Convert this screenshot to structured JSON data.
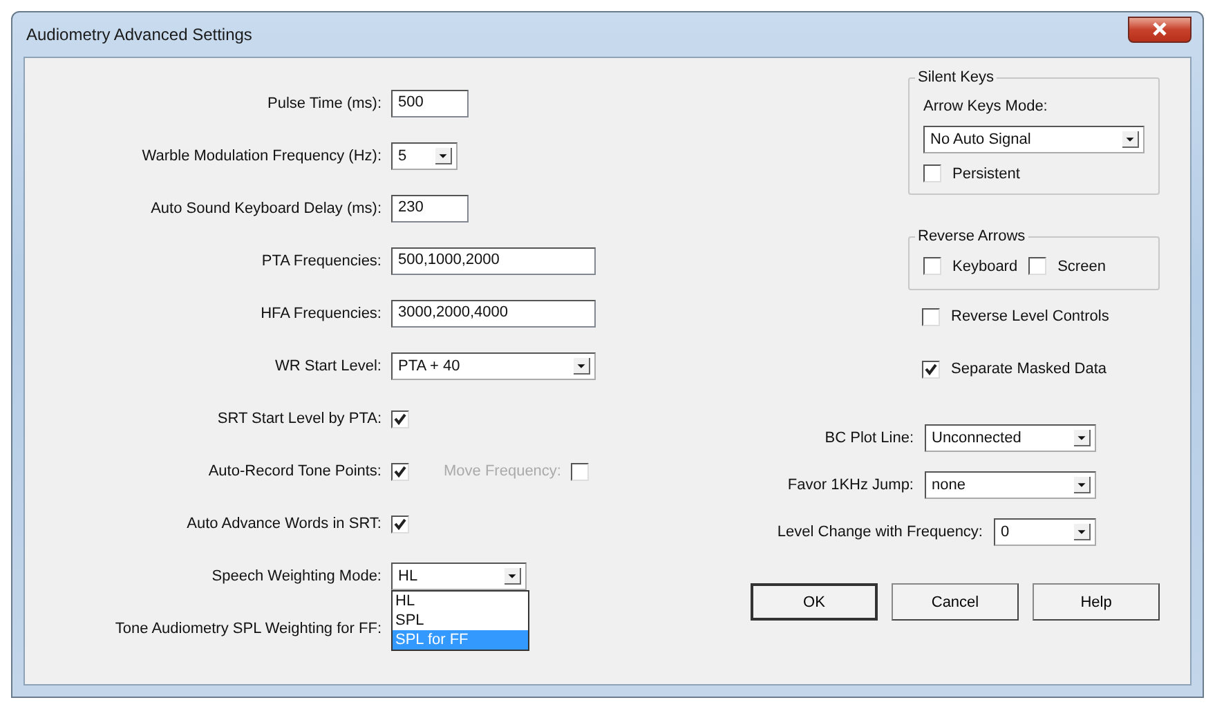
{
  "window": {
    "title": "Audiometry Advanced Settings"
  },
  "left_fields": [
    {
      "kind": "text",
      "label": "Pulse Time (ms):",
      "value": "500"
    },
    {
      "kind": "combo",
      "label": "Warble Modulation Frequency (Hz):",
      "value": "5"
    },
    {
      "kind": "text",
      "label": "Auto Sound Keyboard Delay (ms):",
      "value": "230"
    },
    {
      "kind": "text",
      "label": "PTA Frequencies:",
      "value": "500,1000,2000"
    },
    {
      "kind": "text",
      "label": "HFA Frequencies:",
      "value": "3000,2000,4000"
    },
    {
      "kind": "combo",
      "label": "WR Start Level:",
      "value": "PTA + 40"
    },
    {
      "kind": "check",
      "label": "SRT Start Level by PTA:",
      "checked": true
    },
    {
      "kind": "check",
      "label": "Auto-Record Tone Points:",
      "checked": true,
      "extra": {
        "label": "Move Frequency:",
        "checked": false,
        "disabled": true
      }
    },
    {
      "kind": "check",
      "label": "Auto Advance Words in SRT:",
      "checked": true
    },
    {
      "kind": "combo",
      "label": "Speech Weighting Mode:",
      "value": "HL",
      "dropdown": [
        {
          "label": "HL",
          "highlighted": false
        },
        {
          "label": "SPL",
          "highlighted": false
        },
        {
          "label": "SPL for FF",
          "highlighted": true
        }
      ]
    },
    {
      "kind": "label",
      "label": "Tone Audiometry SPL Weighting for FF:"
    }
  ],
  "silent_keys": {
    "title": "Silent Keys",
    "mode_label": "Arrow Keys Mode:",
    "mode_value": "No Auto Signal",
    "persistent": {
      "label": "Persistent",
      "checked": false
    }
  },
  "reverse_arrows": {
    "title": "Reverse Arrows",
    "checks": [
      {
        "label": "Keyboard",
        "checked": false
      },
      {
        "label": "Screen",
        "checked": false
      }
    ]
  },
  "right_checks": [
    {
      "label": "Reverse Level Controls",
      "checked": false
    },
    {
      "label": "Separate Masked Data",
      "checked": true
    }
  ],
  "right_combos": [
    {
      "label": "BC Plot Line:",
      "value": "Unconnected"
    },
    {
      "label": "Favor 1KHz Jump:",
      "value": "none"
    },
    {
      "label": "Level Change with Frequency:",
      "value": "0"
    }
  ],
  "buttons": [
    {
      "label": "OK",
      "default": true
    },
    {
      "label": "Cancel",
      "default": false
    },
    {
      "label": "Help",
      "default": false
    }
  ]
}
